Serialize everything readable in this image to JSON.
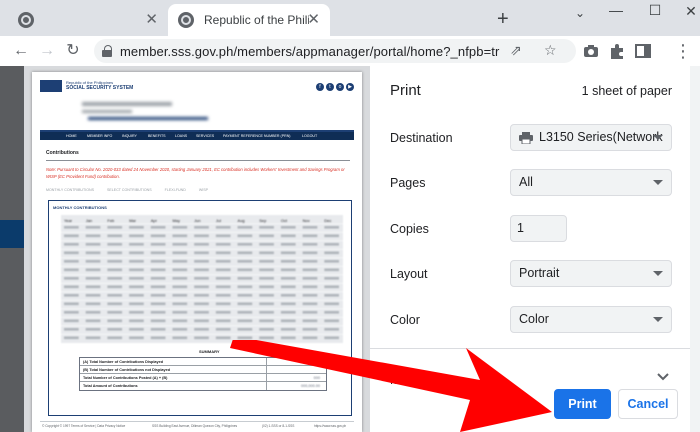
{
  "browser": {
    "tabs": [
      {
        "title": "",
        "active": false
      },
      {
        "title": "Republic of the Philippine",
        "active": true
      }
    ],
    "new_tab": "+",
    "window_controls": {
      "minimize": "—",
      "maximize": "☐",
      "close": "✕",
      "chevron": "⌄"
    },
    "url": "member.sss.gov.ph/members/appmanager/portal/home?_nfpb=true&_nf..."
  },
  "preview": {
    "org_line1": "Republic of the Philippines",
    "org_line2": "SOCIAL SECURITY SYSTEM",
    "nav_items": [
      "HOME",
      "MEMBER INFO",
      "INQUIRY",
      "BENEFITS",
      "LOANS",
      "SERVICES",
      "PAYMENT REFERENCE NUMBER (PRN)",
      "LOGOUT"
    ],
    "section_title": "Contributions",
    "note": "Note: Pursuant to Circular No. 2020-033 dated 24 November 2020, starting January 2021, EC contribution includes Workers' Investment and Savings Program or WISP (EC Provident Fund) contribution.",
    "sub_tabs": [
      "MONTHLY CONTRIBUTIONS",
      "SELECT CONTRIBUTIONS",
      "FLEXI-FUND",
      "WISP"
    ],
    "table_title": "MONTHLY CONTRIBUTIONS",
    "months": [
      "Year",
      "Jan",
      "Feb",
      "Mar",
      "Apr",
      "May",
      "Jun",
      "Jul",
      "Aug",
      "Sep",
      "Oct",
      "Nov",
      "Dec"
    ],
    "summary_title": "SUMMARY",
    "summary_rows": [
      {
        "label": "(A) Total Number of Contributions Displayed",
        "value": ""
      },
      {
        "label": "(B) Total Number of Contributions not Displayed",
        "value": ""
      },
      {
        "label": "Total Number of Contributions Posted (A) + (B)",
        "value": "000"
      },
      {
        "label": "Total Amount of Contributions",
        "value": "000,000.00"
      }
    ],
    "footer": [
      "© Copyright © 1997 Terms of Service | Data Privacy Notice",
      "SSS Building East Avenue, Diliman Quezon City, Philippines",
      "(02) 1-SSS or 8-1-SSS",
      "https://www.sss.gov.ph"
    ]
  },
  "print": {
    "title": "Print",
    "sheets": "1 sheet of paper",
    "destination_label": "Destination",
    "destination_value": "L3150 Series(Network",
    "pages_label": "Pages",
    "pages_value": "All",
    "copies_label": "Copies",
    "copies_value": "1",
    "layout_label": "Layout",
    "layout_value": "Portrait",
    "color_label": "Color",
    "color_value": "Color",
    "more_settings": "More settings",
    "print_button": "Print",
    "cancel_button": "Cancel"
  },
  "colors": {
    "accent": "#1a73e8",
    "sss_blue": "#1d3f74",
    "arrow_red": "#ff0000",
    "note_red": "#d93025"
  }
}
